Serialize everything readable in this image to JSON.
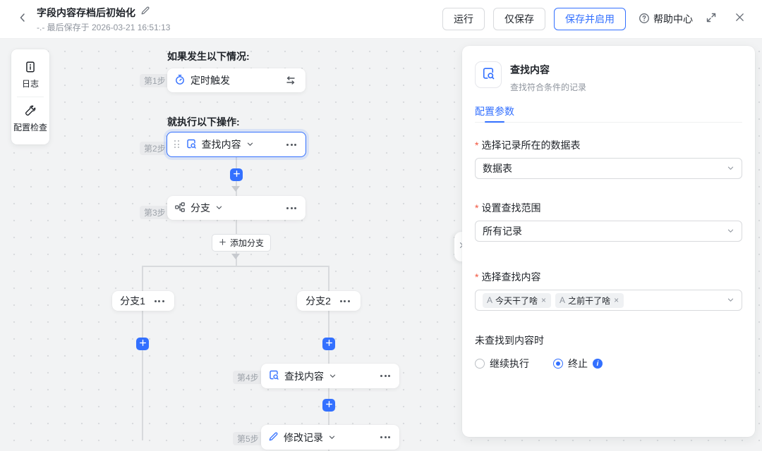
{
  "header": {
    "title": "字段内容存档后初始化",
    "last_saved": "-.- 最后保存于 2026-03-21 16:51:13",
    "buttons": {
      "run": "运行",
      "save_only": "仅保存",
      "save_and_enable": "保存并启用",
      "help": "帮助中心"
    }
  },
  "toolbox": {
    "log": "日志",
    "config_check": "配置检查"
  },
  "flow": {
    "trigger_section_title": "如果发生以下情况:",
    "action_section_title": "就执行以下操作:",
    "step1": {
      "badge": "第1步",
      "label": "定时触发"
    },
    "step2": {
      "badge": "第2步",
      "label": "查找内容"
    },
    "step3": {
      "badge": "第3步",
      "label": "分支"
    },
    "step4": {
      "badge": "第4步",
      "label": "查找内容"
    },
    "step5": {
      "badge": "第5步",
      "label": "修改记录"
    },
    "add_branch_label": "添加分支",
    "branch1_label": "分支1",
    "branch2_label": "分支2"
  },
  "panel": {
    "title": "查找内容",
    "subtitle": "查找符合条件的记录",
    "tab": "配置参数",
    "required_marker": "*",
    "field_table": {
      "label": "选择记录所在的数据表",
      "value": "数据表"
    },
    "field_range": {
      "label": "设置查找范围",
      "value": "所有记录"
    },
    "field_content": {
      "label": "选择查找内容",
      "tags": [
        "今天干了啥",
        "之前干了啥"
      ],
      "tag_type_glyph": "A"
    },
    "not_found": {
      "label": "未查找到内容时",
      "option_continue": "继续执行",
      "option_stop": "终止"
    }
  },
  "icons": {
    "back": "chevron-left",
    "edit": "pencil",
    "help": "question-circle",
    "fullscreen": "expand",
    "close": "x",
    "log": "document-info",
    "config_check": "wrench",
    "timer": "stopwatch",
    "swap": "arrows-left-right",
    "search_record": "document-magnifier",
    "branch": "sitemap-split",
    "modify_record": "pencil",
    "add": "plus",
    "more": "ellipsis",
    "collapse": "chevron-right",
    "info": "info-circle"
  },
  "colors": {
    "accent": "#3370ff",
    "required": "#f2543d",
    "canvas_bg": "#f2f3f4"
  }
}
